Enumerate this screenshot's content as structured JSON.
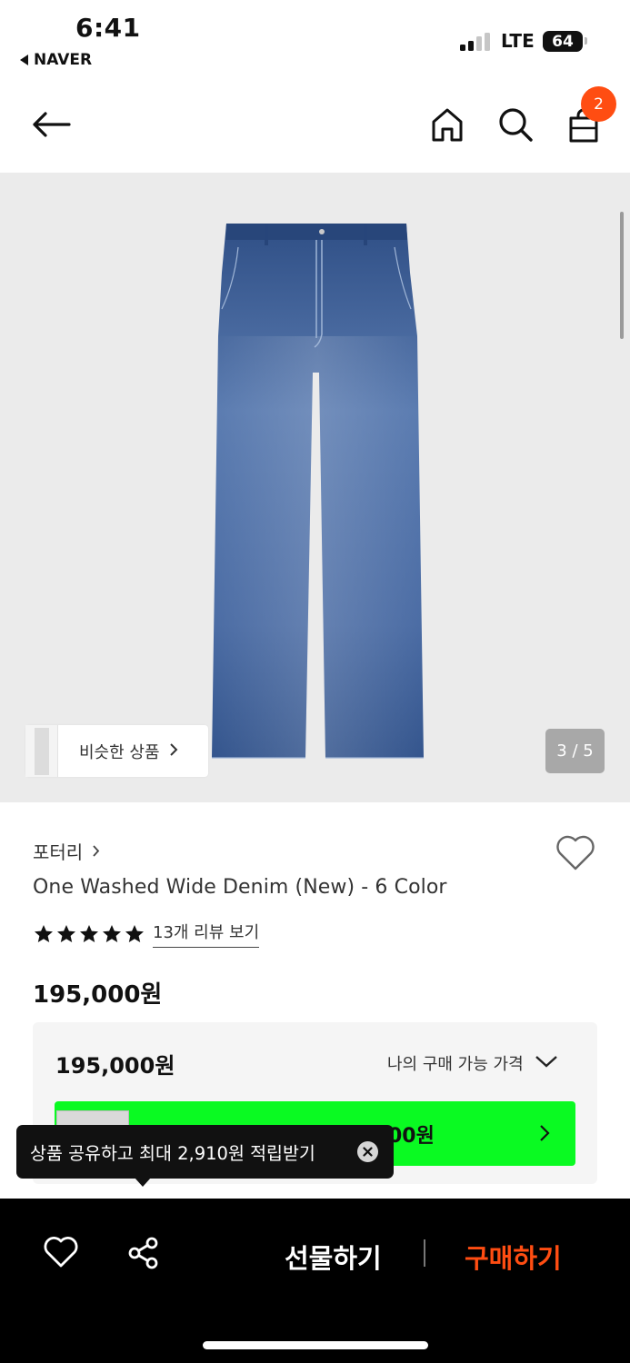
{
  "status_bar": {
    "time": "6:41",
    "back_app": "NAVER",
    "network": "LTE",
    "battery": "64"
  },
  "nav": {
    "cart_count": "2",
    "icons": [
      "back-arrow-icon",
      "home-icon",
      "search-icon",
      "shopping-bag-icon"
    ]
  },
  "gallery": {
    "similar_label": "비슷한 상품",
    "page_counter": "3 / 5"
  },
  "product": {
    "brand": "포터리",
    "title": "One Washed Wide Denim (New) - 6 Color",
    "rating_stars": 5,
    "review_link": "13개 리뷰 보기",
    "price": "195,000원"
  },
  "price_box": {
    "price": "195,000원",
    "dropdown_label": "나의 구매 가능 가격",
    "banner_text": "00원"
  },
  "tooltip": {
    "text": "상품 공유하고 최대 2,910원 적립받기"
  },
  "bottom_bar": {
    "gift_label": "선물하기",
    "buy_label": "구매하기"
  },
  "colors": {
    "accent": "#ff4d12",
    "banner_green": "#0afa22"
  }
}
